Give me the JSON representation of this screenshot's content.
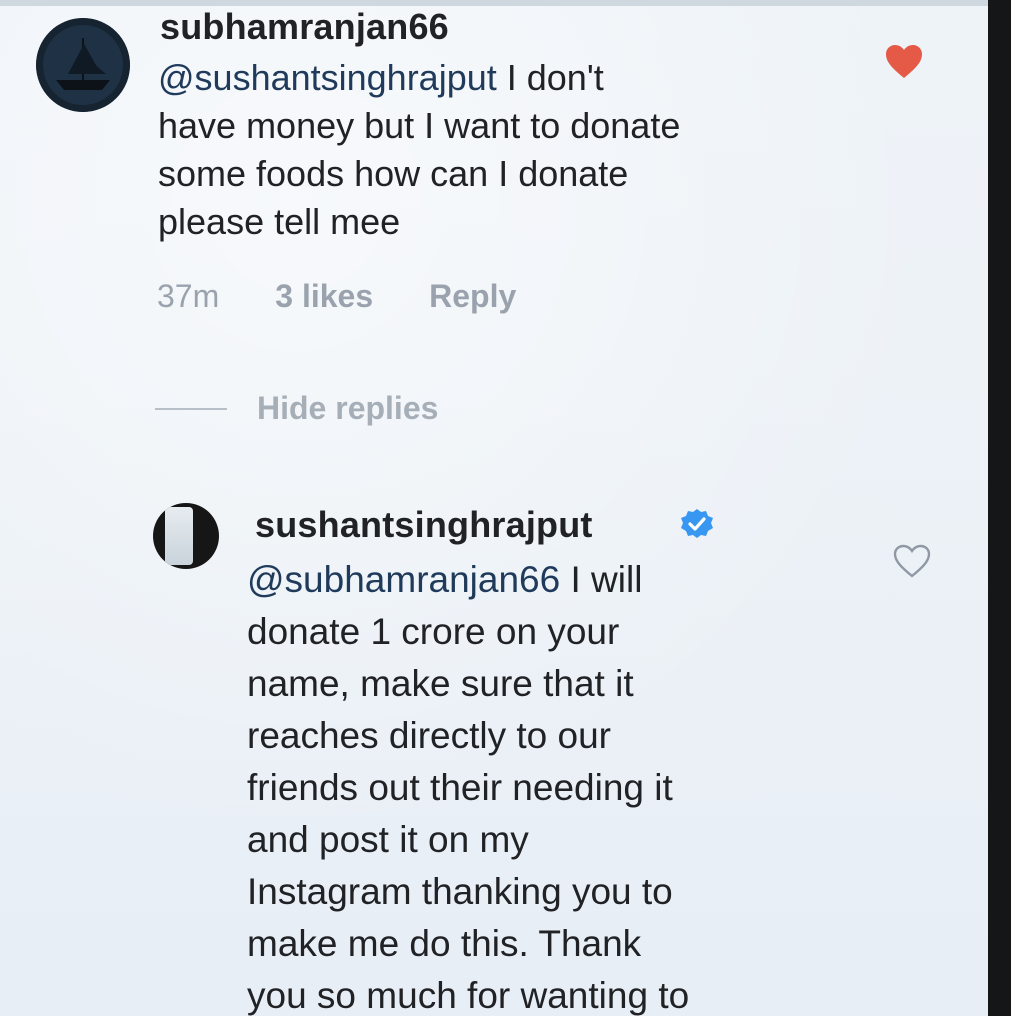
{
  "comments": {
    "parent": {
      "username": "subhamranjan66",
      "mention": "@sushantsinghrajput",
      "text": " I don't\nhave money but I want to donate\nsome foods how can I donate\nplease tell mee",
      "time": "37m",
      "likes": "3 likes",
      "reply_label": "Reply",
      "liked": true
    },
    "hide_replies_label": "Hide replies",
    "reply": {
      "username": "sushantsinghrajput",
      "verified": true,
      "mention": "@subhamranjan66",
      "text": " I will\ndonate 1 crore on your\nname, make sure that it\nreaches directly to our\nfriends out their needing it\nand post it on my\nInstagram thanking you to\nmake me do this. Thank\nyou so much for wanting to",
      "liked": false
    }
  },
  "colors": {
    "text": "#202225",
    "meta": "#9aa3ad",
    "heart_liked": "#e45a47",
    "verified_blue": "#3897f0",
    "background": "#eef3f8"
  },
  "icons": {
    "parent_like": "heart-filled-icon",
    "reply_like": "heart-outline-icon",
    "verified": "verified-badge-icon"
  }
}
